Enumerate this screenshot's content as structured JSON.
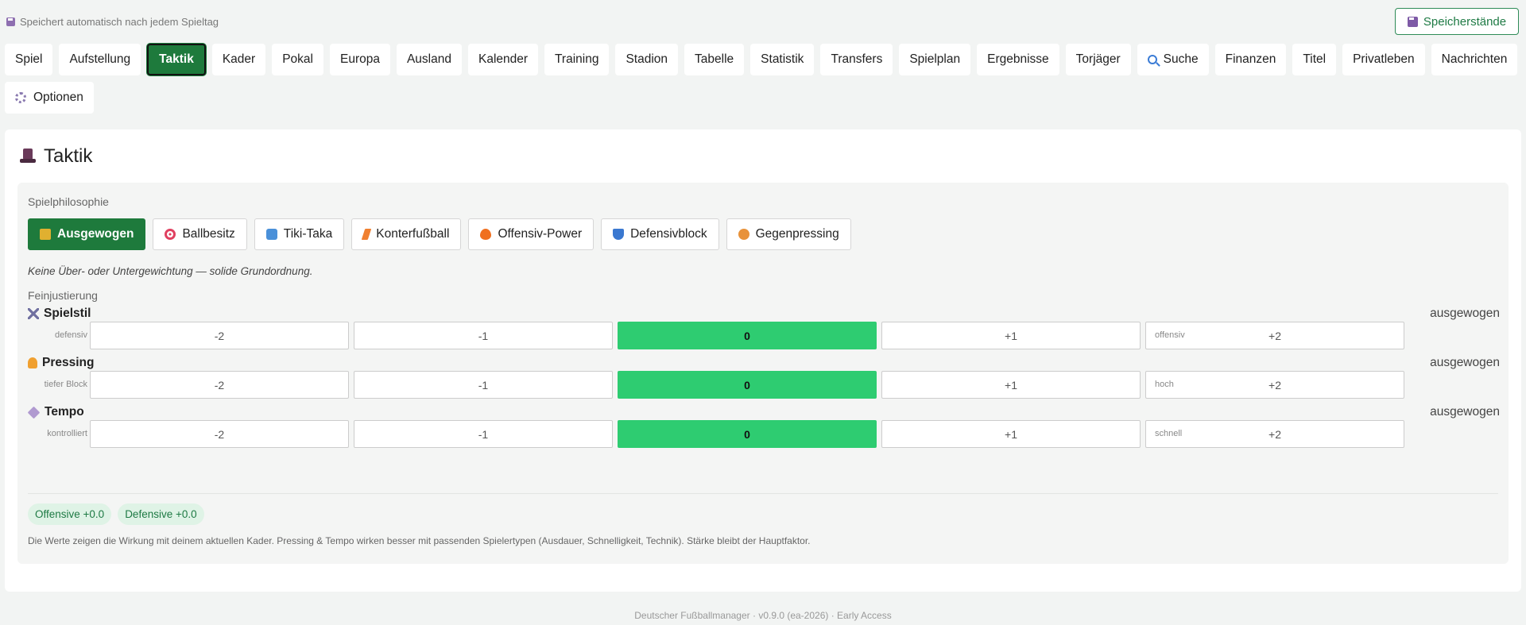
{
  "topbar": {
    "autosave_text": "Speichert automatisch nach jedem Spieltag",
    "saves_label": "Speicherstände",
    "floppy_icon": "floppy-disk-icon"
  },
  "nav": {
    "tabs": [
      {
        "label": "Spiel"
      },
      {
        "label": "Aufstellung"
      },
      {
        "label": "Taktik",
        "active": true
      },
      {
        "label": "Kader"
      },
      {
        "label": "Pokal"
      },
      {
        "label": "Europa"
      },
      {
        "label": "Ausland"
      },
      {
        "label": "Kalender"
      },
      {
        "label": "Training"
      },
      {
        "label": "Stadion"
      },
      {
        "label": "Tabelle"
      },
      {
        "label": "Statistik"
      },
      {
        "label": "Transfers"
      },
      {
        "label": "Spielplan"
      },
      {
        "label": "Ergebnisse"
      },
      {
        "label": "Torjäger"
      },
      {
        "label": "Suche",
        "icon": "magnifier-icon"
      },
      {
        "label": "Finanzen"
      },
      {
        "label": "Titel"
      },
      {
        "label": "Privatleben"
      },
      {
        "label": "Nachrichten"
      },
      {
        "label": "Optionen",
        "icon": "gear-icon"
      }
    ]
  },
  "page": {
    "title": "Taktik",
    "title_icon": "top-hat-icon"
  },
  "philosophy": {
    "label": "Spielphilosophie",
    "options": [
      {
        "label": "Ausgewogen",
        "icon": "scale-icon",
        "selected": true
      },
      {
        "label": "Ballbesitz",
        "icon": "target-icon"
      },
      {
        "label": "Tiki-Taka",
        "icon": "cycle-icon"
      },
      {
        "label": "Konterfußball",
        "icon": "lightning-icon"
      },
      {
        "label": "Offensiv-Power",
        "icon": "fire-icon"
      },
      {
        "label": "Defensivblock",
        "icon": "shield-icon"
      },
      {
        "label": "Gegenpressing",
        "icon": "tiger-icon"
      }
    ],
    "description": "Keine Über- oder Untergewichtung — solide Grundordnung."
  },
  "finetuning": {
    "label": "Feinjustierung",
    "steps": [
      "-2",
      "-1",
      "0",
      "+1",
      "+2"
    ],
    "sliders": [
      {
        "name": "Spielstil",
        "icon": "crossed-swords-icon",
        "state": "ausgewogen",
        "left": "defensiv",
        "right": "offensiv",
        "value": 0
      },
      {
        "name": "Pressing",
        "icon": "runner-icon",
        "state": "ausgewogen",
        "left": "tiefer Block",
        "right": "hoch",
        "value": 0
      },
      {
        "name": "Tempo",
        "icon": "diamond-icon",
        "state": "ausgewogen",
        "left": "kontrolliert",
        "right": "schnell",
        "value": 0
      }
    ]
  },
  "effects": {
    "offensive": "Offensive +0.0",
    "defensive": "Defensive +0.0",
    "note": "Die Werte zeigen die Wirkung mit deinem aktuellen Kader. Pressing & Tempo wirken besser mit passenden Spielertypen (Ausdauer, Schnelligkeit, Technik). Stärke bleibt der Hauptfaktor."
  },
  "footer": {
    "text": "Deutscher Fußballmanager · v0.9.0 (ea-2026) · Early Access"
  },
  "colors": {
    "accent_green": "#1e7a3c",
    "selected_step": "#2ecc71",
    "badge_bg": "#dff3e6"
  }
}
